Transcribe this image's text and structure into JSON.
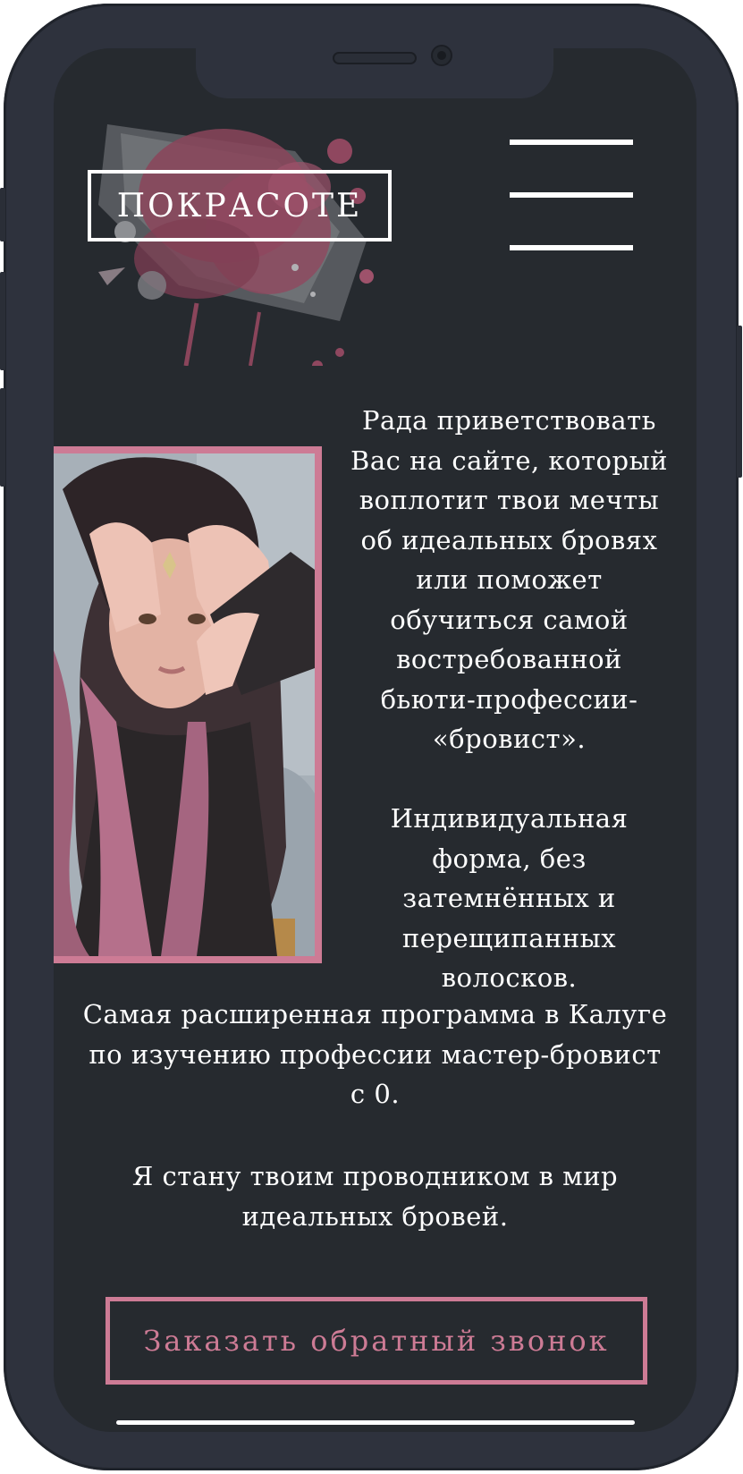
{
  "header": {
    "logo_text": "ПОКРАСОТЕ",
    "menu_icon": "hamburger-menu-icon"
  },
  "content": {
    "intro": "Рада приветствовать\nВас на сайте, который\nвоплотит твои мечты\nоб идеальных бровях\nили поможет\nобучиться самой\nвостребованной\nбьюти-профессии-\n«бровист».\n\nИндивидуальная\nформа, без\nзатемнённых и\nперещипанных\nволосков.",
    "program": "Самая расширенная программа в Калуге\nпо изучению профессии мастер-бровист\nс 0.",
    "guide": "Я стану твоим проводником в мир\nидеальных бровей."
  },
  "cta": {
    "label": "Заказать обратный звонок"
  },
  "colors": {
    "accent": "#cd7b95",
    "screen_bg": "#262a2f",
    "phone_frame": "#2e323d",
    "text": "#ffffff"
  }
}
